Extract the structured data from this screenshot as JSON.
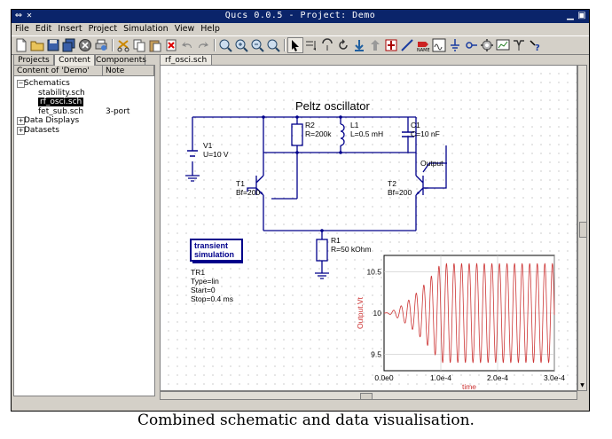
{
  "window": {
    "title": "Qucs 0.0.5 - Project: Demo"
  },
  "menu": [
    "File",
    "Edit",
    "Insert",
    "Project",
    "Simulation",
    "View",
    "Help"
  ],
  "toolbar": {
    "icons": [
      "new-file-icon",
      "open-folder-icon",
      "save-icon",
      "save-all-icon",
      "close-icon",
      "print-icon",
      "cut-icon",
      "copy-icon",
      "paste-icon",
      "delete-icon",
      "undo-icon",
      "redo-icon",
      "zoom-fit-icon",
      "zoom-in-icon",
      "zoom-out-icon",
      "zoom-original-icon",
      "select-arrow-icon",
      "mirror-x-icon",
      "mirror-y-icon",
      "rotate-icon",
      "move-icon",
      "deactivate-icon",
      "wire-icon",
      "label-name-icon",
      "equation-icon",
      "ground-icon",
      "port-icon",
      "simulate-icon",
      "display-data-icon",
      "marker-icon",
      "help-icon"
    ]
  },
  "panel_tabs": [
    "Projects",
    "Content",
    "Components"
  ],
  "content": {
    "header_name": "Content of 'Demo'",
    "header_note": "Note",
    "schematics": "Schematics",
    "files": [
      {
        "name": "stability.sch",
        "note": ""
      },
      {
        "name": "rf_osci.sch",
        "note": ""
      },
      {
        "name": "fet_sub.sch",
        "note": "3-port"
      }
    ],
    "data_displays": "Data Displays",
    "datasets": "Datasets"
  },
  "doc_tab": "rf_osci.sch",
  "schematic": {
    "title": "Peltz oscillator",
    "v1_name": "V1",
    "v1_value": "U=10 V",
    "r2_name": "R2",
    "r2_value": "R=200k",
    "l1_name": "L1",
    "l1_value": "L=0.5 mH",
    "c1_name": "C1",
    "c1_value": "C=10 nF",
    "t1_name": "T1",
    "t1_value": "Bf=200",
    "t2_name": "T2",
    "t2_value": "Bf=200",
    "output_label": "Output",
    "r1_name": "R1",
    "r1_value": "R=50 kOhm",
    "sim_title_line1": "transient",
    "sim_title_line2": "simulation",
    "tr_name": "TR1",
    "tr_type": "Type=lin",
    "tr_start": "Start=0",
    "tr_stop": "Stop=0.4 ms"
  },
  "chart_data": {
    "type": "line",
    "xlabel": "time",
    "ylabel": "Output.Vt",
    "xticks": [
      "0.0e0",
      "1.0e-4",
      "2.0e-4",
      "3.0e-4"
    ],
    "yticks": [
      "10.5",
      "10",
      "9.5"
    ],
    "xlim": [
      0,
      0.0003
    ],
    "ylim": [
      9.3,
      10.7
    ],
    "series": [
      {
        "color": "#cc3333",
        "shape": "sinusoid, center 10, amplitude growing from ~0 to ~0.6 by 1.0e-4, period ~1.33e-5"
      }
    ]
  },
  "caption": "Combined schematic and data visualisation."
}
